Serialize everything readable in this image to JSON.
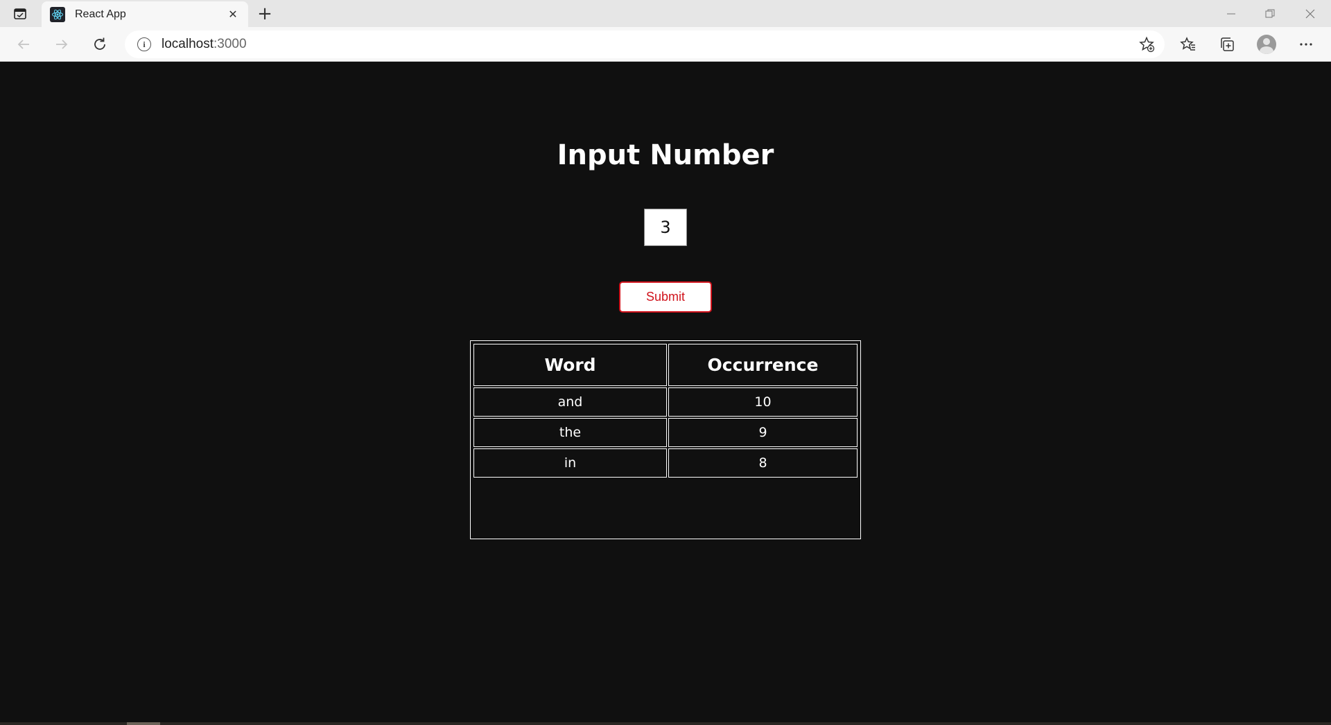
{
  "browser": {
    "tab_title": "React App",
    "tab_close": "✕",
    "new_tab": "+",
    "url_host": "localhost",
    "url_port": ":3000"
  },
  "app": {
    "heading": "Input Number",
    "number_input_value": "3",
    "submit_label": "Submit"
  },
  "table": {
    "headers": [
      "Word",
      "Occurrence"
    ],
    "rows": [
      {
        "word": "and",
        "occurrence": "10"
      },
      {
        "word": "the",
        "occurrence": "9"
      },
      {
        "word": "in",
        "occurrence": "8"
      }
    ]
  },
  "colors": {
    "page_background": "#101010",
    "accent_red": "#d0121b"
  },
  "icons": [
    "tab-actions-icon",
    "react-favicon-icon",
    "close-icon",
    "plus-icon",
    "minimize-icon",
    "restore-icon",
    "window-close-icon",
    "back-icon",
    "forward-icon",
    "refresh-icon",
    "info-icon",
    "add-favorite-icon",
    "favorites-icon",
    "collections-icon",
    "profile-icon",
    "more-icon"
  ]
}
